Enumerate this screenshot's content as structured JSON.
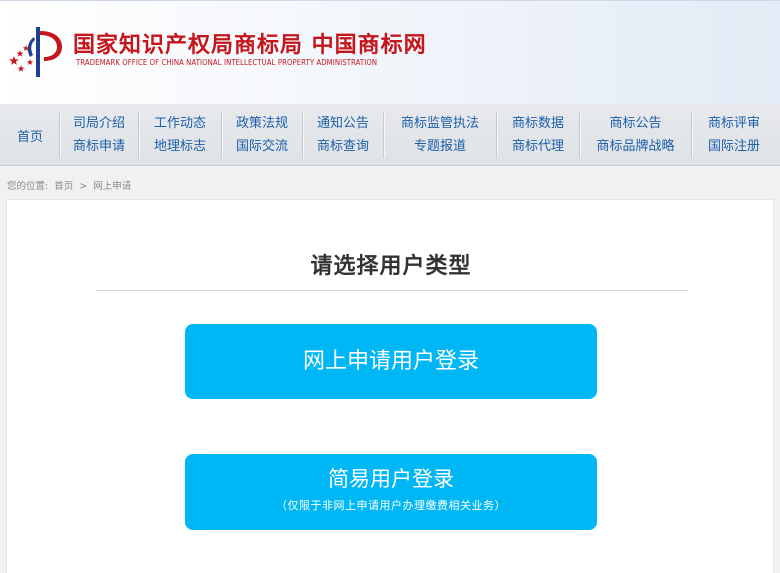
{
  "header": {
    "title_cn": "国家知识产权局商标局 中国商标网",
    "title_en": "TRADEMARK OFFICE OF CHINA NATIONAL INTELLECTUAL PROPERTY ADMINISTRATION",
    "brand_color": "#c4161c"
  },
  "nav": {
    "home": "首页",
    "groups": [
      {
        "top": "司局介绍",
        "bottom": "商标申请"
      },
      {
        "top": "工作动态",
        "bottom": "地理标志"
      },
      {
        "top": "政策法规",
        "bottom": "国际交流"
      },
      {
        "top": "通知公告",
        "bottom": "商标查询"
      },
      {
        "top": "商标监管执法",
        "bottom": "专题报道"
      },
      {
        "top": "商标数据",
        "bottom": "商标代理"
      },
      {
        "top": "商标公告",
        "bottom": "商标品牌战略"
      },
      {
        "top": "商标评审",
        "bottom": "国际注册"
      }
    ],
    "link_color": "#1b5faa"
  },
  "breadcrumb": {
    "prefix": "您的位置:",
    "home": "首页",
    "separator": ">",
    "current": "网上申请"
  },
  "main": {
    "title": "请选择用户类型",
    "online_login_label": "网上申请用户登录",
    "simple_login_label": "简易用户登录",
    "simple_login_note": "（仅限于非网上申请用户办理缴费相关业务）",
    "button_color": "#00b7f5"
  }
}
